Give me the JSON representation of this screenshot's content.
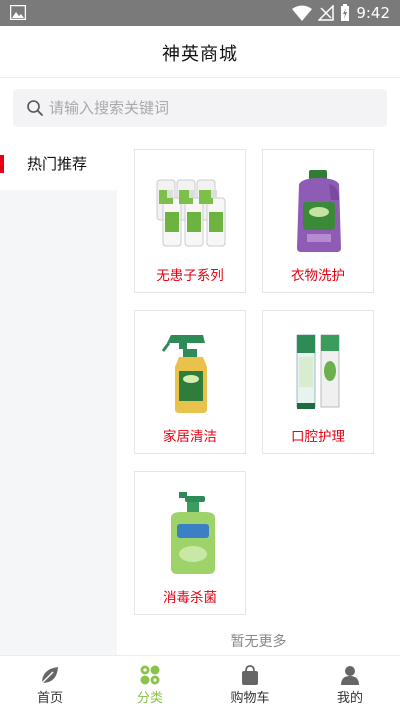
{
  "status_bar": {
    "time": "9:42",
    "icons": [
      "picture-icon",
      "wifi-icon",
      "no-signal-icon",
      "battery-charging-icon"
    ]
  },
  "header": {
    "title": "神英商城"
  },
  "search": {
    "placeholder": "请输入搜索关键词",
    "value": ""
  },
  "sidebar": {
    "items": [
      {
        "label": "热门推荐",
        "active": true
      }
    ]
  },
  "categories": [
    {
      "label": "无患子系列",
      "image": "bottles-set"
    },
    {
      "label": "衣物洗护",
      "image": "laundry-bottle"
    },
    {
      "label": "家居清洁",
      "image": "spray-bottle"
    },
    {
      "label": "口腔护理",
      "image": "toothpaste"
    },
    {
      "label": "消毒杀菌",
      "image": "hand-wash-bottle"
    }
  ],
  "no_more_text": "暂无更多",
  "tabbar": {
    "items": [
      {
        "label": "首页",
        "icon": "leaf-icon",
        "active": false
      },
      {
        "label": "分类",
        "icon": "grid-icon",
        "active": true
      },
      {
        "label": "购物车",
        "icon": "bag-icon",
        "active": false
      },
      {
        "label": "我的",
        "icon": "person-icon",
        "active": false
      }
    ]
  },
  "colors": {
    "accent_red": "#e60012",
    "active_green": "#8bc34a",
    "status_bar": "#7a7a7a"
  }
}
